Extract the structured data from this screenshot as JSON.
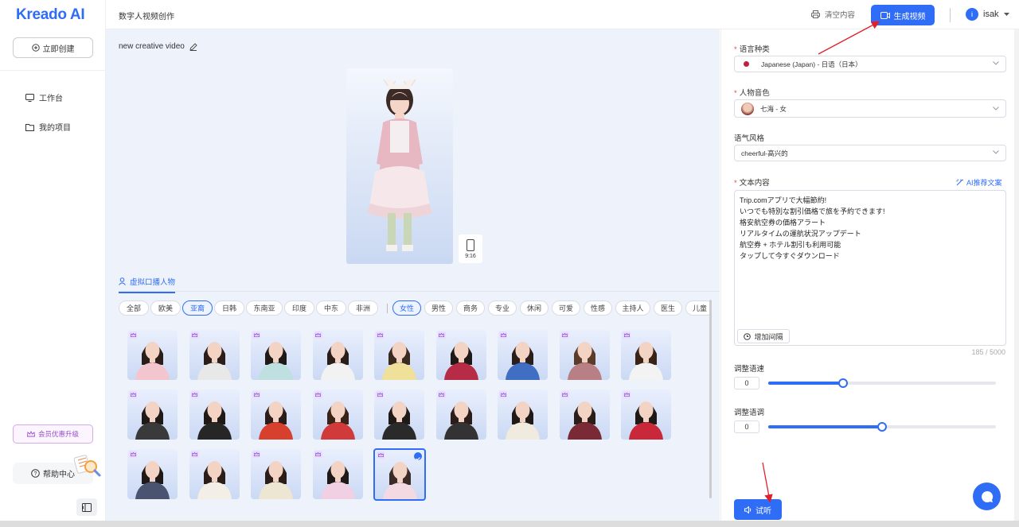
{
  "brand": {
    "logo": "Kreado AI",
    "accent": "#2f6df6"
  },
  "sidebar": {
    "create_label": "立即创建",
    "items": [
      {
        "label": "工作台"
      },
      {
        "label": "我的项目"
      }
    ],
    "vip_label": "会员优惠升级",
    "help_label": "帮助中心"
  },
  "topbar": {
    "page_title": "数字人视频创作",
    "clear_label": "清空内容",
    "generate_label": "生成视频",
    "user_initial": "i",
    "user_name": "isak"
  },
  "editor": {
    "project_title": "new creative video",
    "ratio_label": "9:16",
    "tab_label": "虚拟口播人物",
    "region_chips": [
      "全部",
      "欧美",
      "亚裔",
      "日韩",
      "东南亚",
      "印度",
      "中东",
      "非洲"
    ],
    "region_selected": "亚裔",
    "tag_chips": [
      "女性",
      "男性",
      "商务",
      "专业",
      "休闲",
      "可爱",
      "性感",
      "主持人",
      "医生",
      "儿童"
    ],
    "tag_selected": "女性",
    "avatar_count": 23,
    "selected_avatar_index": 22
  },
  "settings": {
    "language_label": "语言种类",
    "language_value": "Japanese (Japan) - 日语（日本）",
    "voice_label": "人物音色",
    "voice_value": "七海 - 女",
    "style_label": "语气风格",
    "style_value": "cheerful-高兴的",
    "text_label": "文本内容",
    "ai_label": "AI推荐文案",
    "text_lines": [
      "Trip.comアプリで大幅節約!",
      "いつでも特別な割引価格で旅を予約できます!",
      "格安航空券の価格アラート",
      "リアルタイムの運航状況アップデート",
      "航空券 + ホテル割引も利用可能",
      "タップして今すぐダウンロード"
    ],
    "pause_label": "增加间隔",
    "counter": "185 / 5000",
    "speed_label": "调整语速",
    "speed_value": "0",
    "speed_fraction": 0.33,
    "pitch_label": "调整语调",
    "pitch_value": "0",
    "pitch_fraction": 0.5,
    "listen_label": "试听"
  }
}
